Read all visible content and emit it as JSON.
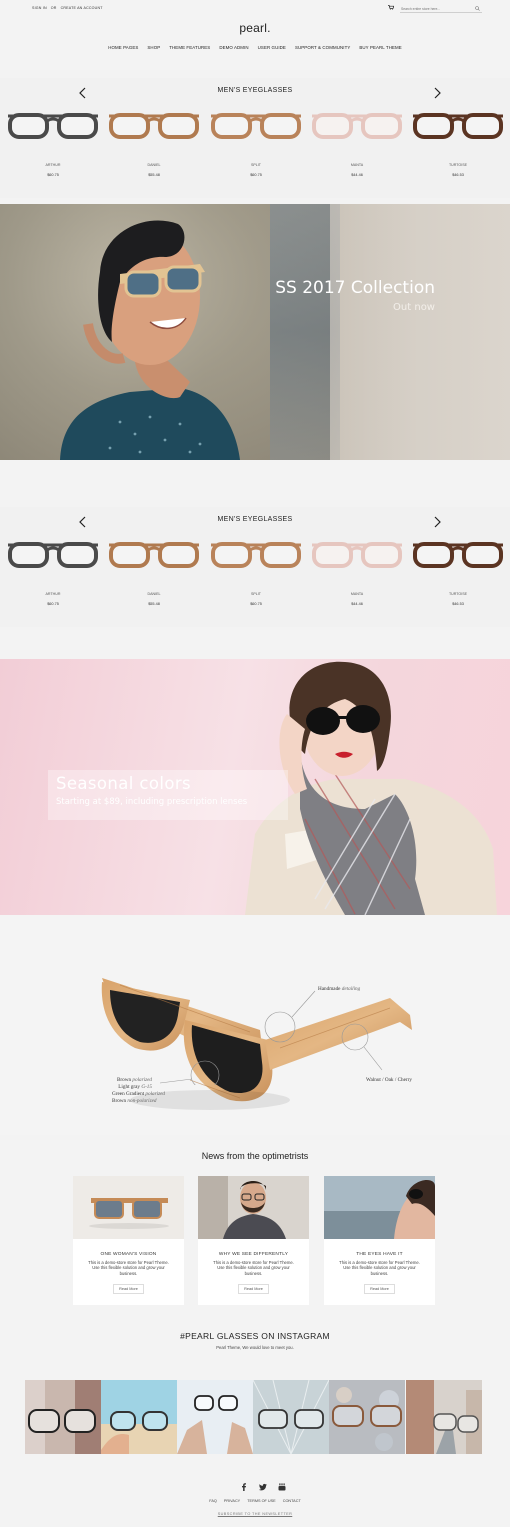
{
  "topbar": {
    "signin": "SIGN IN",
    "or": "OR",
    "create_account": "CREATE AN ACCOUNT",
    "search_placeholder": "Search entire store here..."
  },
  "logo": "pearl.",
  "nav": [
    "HOME PAGES",
    "SHOP",
    "THEME FEATURES",
    "DEMO ADMIN",
    "USER GUIDE",
    "SUPPORT & COMMUNITY",
    "BUY PEARL THEME"
  ],
  "carousel1": {
    "title": "MEN'S EYEGLASSES",
    "products": [
      {
        "name": "ARTHUR",
        "price": "$60.75",
        "color": "#4a4a4a"
      },
      {
        "name": "DANIEL",
        "price": "$55.48",
        "color": "#b07a4f"
      },
      {
        "name": "SPLIT",
        "price": "$60.75",
        "color": "#b9835a"
      },
      {
        "name": "MANTA",
        "price": "$44.46",
        "color": "#e6c6bf"
      },
      {
        "name": "TURTOISE",
        "price": "$46.53",
        "color": "#5b3422"
      }
    ]
  },
  "banner1": {
    "title": "SS 2017 Collection",
    "subtitle": "Out now"
  },
  "carousel2": {
    "title": "MEN'S EYEGLASSES",
    "products": [
      {
        "name": "ARTHUR",
        "price": "$60.75",
        "color": "#4a4a4a"
      },
      {
        "name": "DANIEL",
        "price": "$55.48",
        "color": "#b07a4f"
      },
      {
        "name": "SPLIT",
        "price": "$60.75",
        "color": "#b9835a"
      },
      {
        "name": "MANTA",
        "price": "$44.46",
        "color": "#e6c6bf"
      },
      {
        "name": "TURTOISE",
        "price": "$46.53",
        "color": "#5b3422"
      }
    ]
  },
  "banner2": {
    "title": "Seasonal colors",
    "subtitle": "Starting at $89, including prescription lenses"
  },
  "feature": {
    "handmade": "Handmade",
    "handmade_i": "detailing",
    "woods": "Walnut / Oak / Cherry",
    "lens1": "Brown",
    "lens1_i": "polarized",
    "lens2": "Light gray",
    "lens2_i": "G-15",
    "lens3": "Green Gradient",
    "lens3_i": "polarized",
    "lens4": "Brown",
    "lens4_i": "non-polarized"
  },
  "news": {
    "title": "News from the optimetrists",
    "cards": [
      {
        "title": "ONE WOMAN'S VISION",
        "body": "This is a demo-store store for Pearl Theme. Use this flexible solution and grow your business.",
        "button": "Read More"
      },
      {
        "title": "WHY WE SEE DIFFERENTLY",
        "body": "This is a demo-store store for Pearl Theme. Use this flexible solution and grow your business.",
        "button": "Read More"
      },
      {
        "title": "THE EYES HAVE IT",
        "body": "This is a demo-store store for Pearl Theme. Use this flexible solution and grow your business.",
        "button": "Read More"
      }
    ]
  },
  "instagram": {
    "title": "#PEARL GLASSES ON INSTAGRAM",
    "subtitle": "Pearl Theme, We would love to meet you."
  },
  "footer": {
    "links": [
      "FAQ",
      "PRIVACY",
      "TERMS OF USE",
      "CONTACT"
    ],
    "subscribe": "SUBSCRIBE TO THE NEWSLETTER"
  },
  "colors": {
    "accent": "#222222",
    "pink_banner": "#f4d6dc"
  }
}
